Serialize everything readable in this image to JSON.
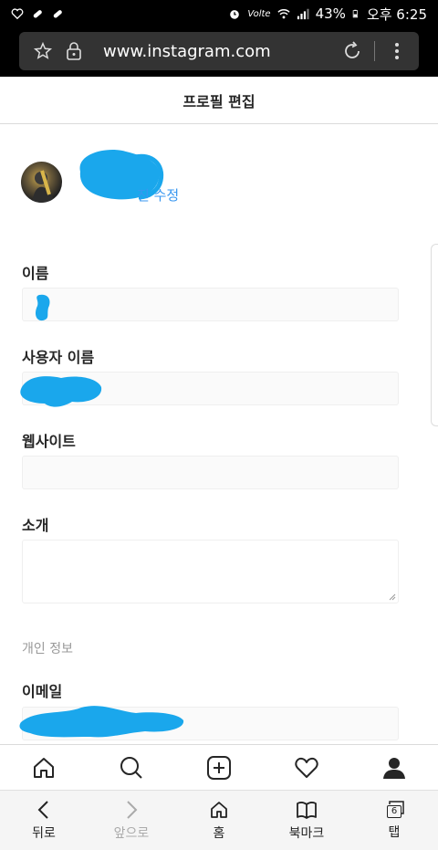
{
  "status_bar": {
    "battery": "43%",
    "time": "오후 6:25",
    "network": "Volte"
  },
  "browser": {
    "url": "www.instagram.com"
  },
  "header": {
    "title": "프로필 편집"
  },
  "profile": {
    "change_photo": "진 수정"
  },
  "fields": [
    {
      "label": "이름"
    },
    {
      "label": "사용자 이름"
    },
    {
      "label": "웹사이트"
    },
    {
      "label": "소개"
    }
  ],
  "private_section": {
    "title": "개인 정보",
    "email_label": "이메일"
  },
  "browser_nav": {
    "back": "뒤로",
    "forward": "앞으로",
    "home": "홈",
    "bookmarks": "북마크",
    "tabs": "탭",
    "tab_count": "6"
  },
  "colors": {
    "link": "#3897f0",
    "redaction": "#1aa7ec"
  }
}
